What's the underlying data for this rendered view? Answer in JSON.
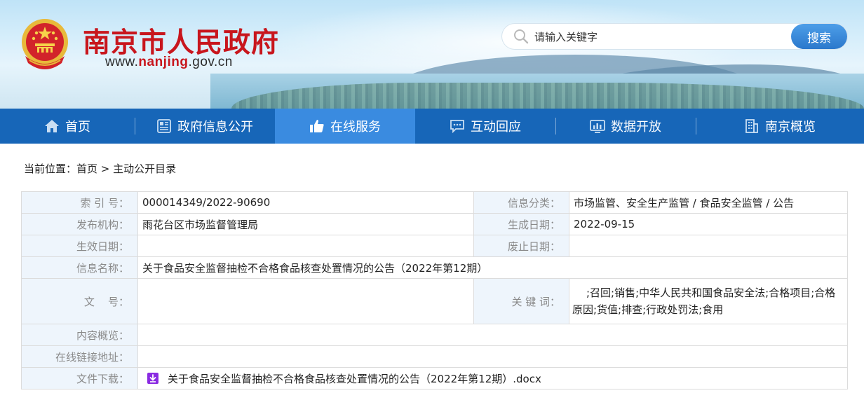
{
  "header": {
    "site_title": "南京市人民政府",
    "site_url_prefix": "www.",
    "site_url_brand": "nanjing",
    "site_url_suffix": ".gov.cn",
    "search": {
      "placeholder": "请输入关键字",
      "button_label": "搜索"
    }
  },
  "nav": {
    "items": [
      {
        "label": "首页",
        "icon": "home-icon"
      },
      {
        "label": "政府信息公开",
        "icon": "document-icon"
      },
      {
        "label": "在线服务",
        "icon": "thumbs-up-icon",
        "active": true
      },
      {
        "label": "互动回应",
        "icon": "chat-icon"
      },
      {
        "label": "数据开放",
        "icon": "chart-icon"
      },
      {
        "label": "南京概览",
        "icon": "building-icon"
      }
    ]
  },
  "breadcrumb": {
    "prefix": "当前位置：",
    "home": "首页",
    "separator": " > ",
    "current": "主动公开目录"
  },
  "info": {
    "index_no_label": "索 引 号：",
    "index_no": "000014349/2022-90690",
    "category_label": "信息分类：",
    "category": "市场监管、安全生产监管 / 食品安全监管 / 公告",
    "publisher_label": "发布机构：",
    "publisher": "雨花台区市场监督管理局",
    "created_label": "生成日期：",
    "created": "2022-09-15",
    "effective_label": "生效日期：",
    "effective": "",
    "repeal_label": "废止日期：",
    "repeal": "",
    "name_label": "信息名称：",
    "name": "关于食品安全监督抽检不合格食品核查处置情况的公告（2022年第12期）",
    "doc_no_label": "文    号：",
    "doc_no": "",
    "keywords_label": "关 键 词：",
    "keywords": ";召回;销售;中华人民共和国食品安全法;合格项目;合格原因;货值;排查;行政处罚法;食用",
    "summary_label": "内容概览：",
    "summary": "",
    "link_label": "在线链接地址：",
    "link": "",
    "download_label": "文件下载：",
    "download_file": "关于食品安全监督抽检不合格食品核查处置情况的公告（2022年第12期）.docx"
  },
  "colors": {
    "brand_red": "#c8161d",
    "nav_blue": "#1766b8",
    "nav_active": "#3a8be0",
    "label_bg": "#eef5fc"
  }
}
